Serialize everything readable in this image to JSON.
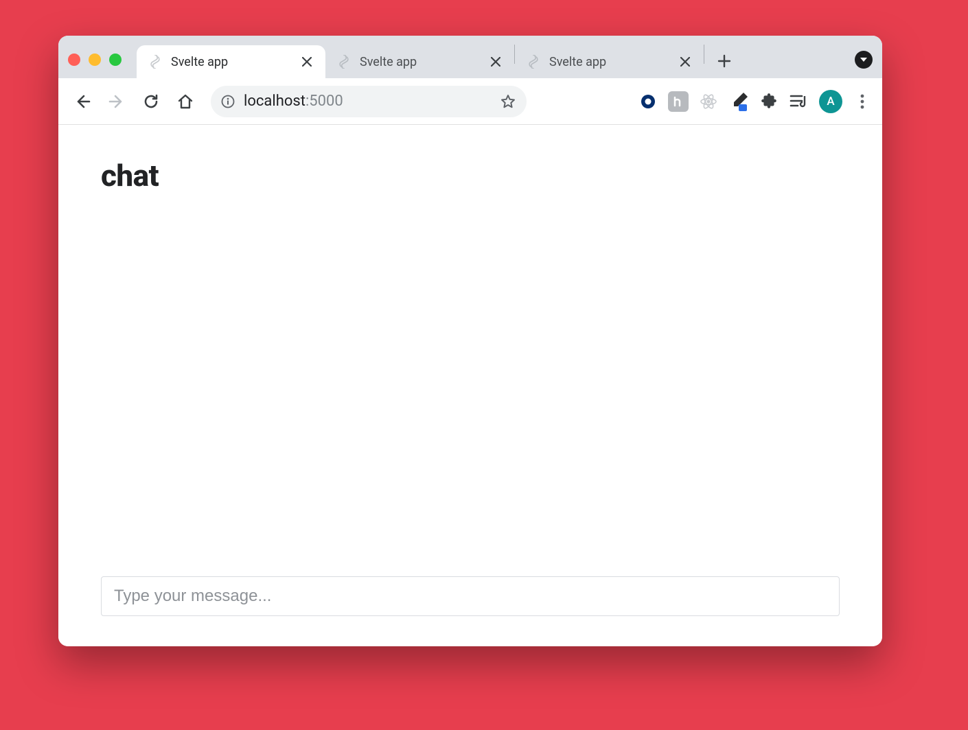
{
  "browser": {
    "tabs": [
      {
        "title": "Svelte app",
        "active": true
      },
      {
        "title": "Svelte app",
        "active": false
      },
      {
        "title": "Svelte app",
        "active": false
      }
    ],
    "url_host": "localhost",
    "url_port": ":5000",
    "avatar_letter": "A"
  },
  "page": {
    "heading": "chat",
    "input_placeholder": "Type your message..."
  }
}
